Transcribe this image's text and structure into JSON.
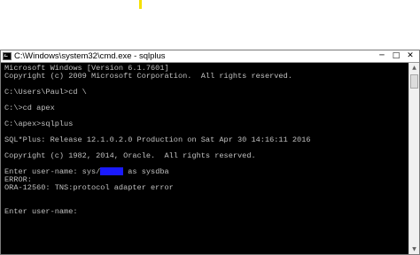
{
  "window": {
    "title": "C:\\Windows\\system32\\cmd.exe - sqlplus",
    "controls": {
      "minimize": "─",
      "maximize": "□",
      "close": "✕"
    }
  },
  "console": {
    "lines": [
      "Microsoft Windows [Version 6.1.7601]",
      "Copyright (c) 2009 Microsoft Corporation.  All rights reserved.",
      "",
      "C:\\Users\\Paul>cd \\",
      "",
      "C:\\>cd apex",
      "",
      "C:\\apex>sqlplus",
      "",
      "SQL*Plus: Release 12.1.0.2.0 Production on Sat Apr 30 14:16:11 2016",
      "",
      "Copyright (c) 1982, 2014, Oracle.  All rights reserved.",
      "",
      "Enter user-name: sys/",
      "ERROR:",
      "ORA-12560: TNS:protocol adapter error",
      "",
      "",
      "Enter user-name:"
    ],
    "login_suffix": " as sysdba",
    "redacted_password": "xxxxx"
  },
  "scrollbar": {
    "up_arrow": "▲",
    "down_arrow": "▼"
  },
  "colors": {
    "console_bg": "#000000",
    "console_text": "#c0c0c0",
    "redaction": "#1a1aff",
    "titlebar_bg": "#ffffff"
  }
}
